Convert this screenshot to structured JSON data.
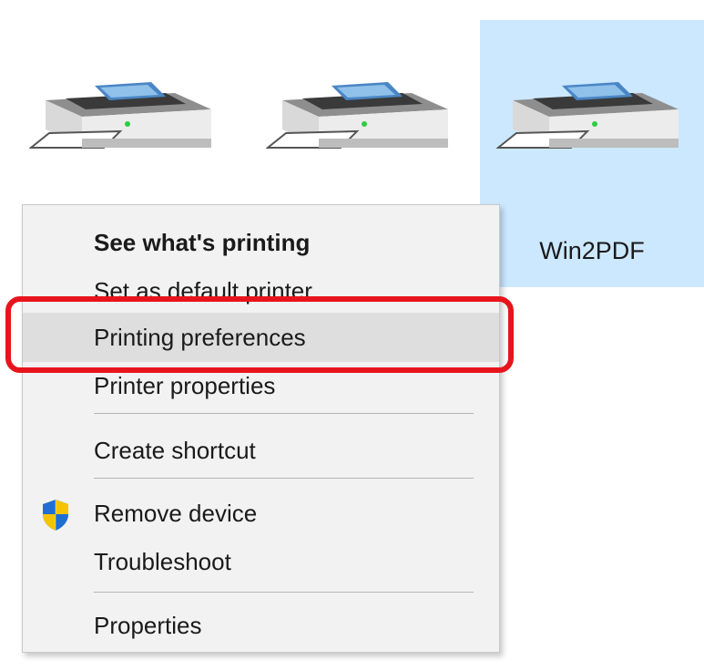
{
  "printers": [
    {
      "label": "",
      "icon": "printer-icon",
      "selected": false
    },
    {
      "label": "",
      "icon": "printer-icon",
      "selected": false
    },
    {
      "label": "Win2PDF",
      "icon": "printer-icon",
      "selected": true
    }
  ],
  "colors": {
    "selected_tile_bg": "#cce8ff",
    "menu_bg": "#f2f2f2",
    "menu_hover_bg": "#dedede",
    "highlight_border": "#e8141c"
  },
  "context_menu": {
    "items": [
      {
        "label": "See what's printing",
        "bold": true
      },
      {
        "label": "Set as default printer"
      },
      {
        "label": "Printing preferences",
        "highlighted": true
      },
      {
        "label": "Printer properties"
      },
      {
        "label": "Create shortcut"
      },
      {
        "label": "Remove device",
        "icon": "uac-shield-icon"
      },
      {
        "label": "Troubleshoot"
      },
      {
        "label": "Properties"
      }
    ]
  }
}
